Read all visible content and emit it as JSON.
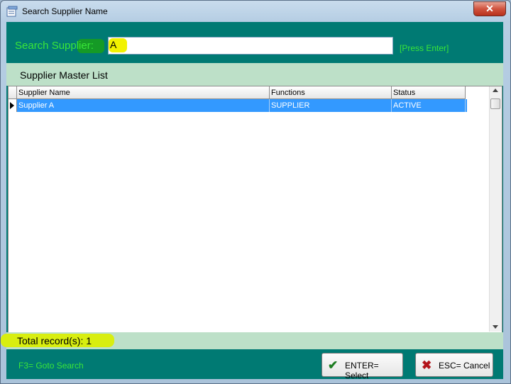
{
  "window": {
    "title": "Search Supplier Name",
    "close_glyph": "✕"
  },
  "search": {
    "label": "Search Supplier:",
    "value": "A",
    "hint": "[Press Enter]"
  },
  "list": {
    "title": "Supplier Master List",
    "columns": [
      "Supplier Name",
      "Functions",
      "Status"
    ],
    "rows": [
      {
        "supplier_name": "Supplier A",
        "functions": "SUPPLIER",
        "status": "ACTIVE"
      }
    ]
  },
  "status": {
    "total": "Total record(s): 1"
  },
  "footer": {
    "goto": "F3= Goto Search",
    "select_label": "ENTER= Select",
    "cancel_label": "ESC= Cancel",
    "select_icon": "checkmark-icon",
    "cancel_icon": "x-icon"
  },
  "colors": {
    "teal": "#007a73",
    "mint": "#bde0c8",
    "hint_green": "#39e639",
    "selection": "#3399ff"
  }
}
